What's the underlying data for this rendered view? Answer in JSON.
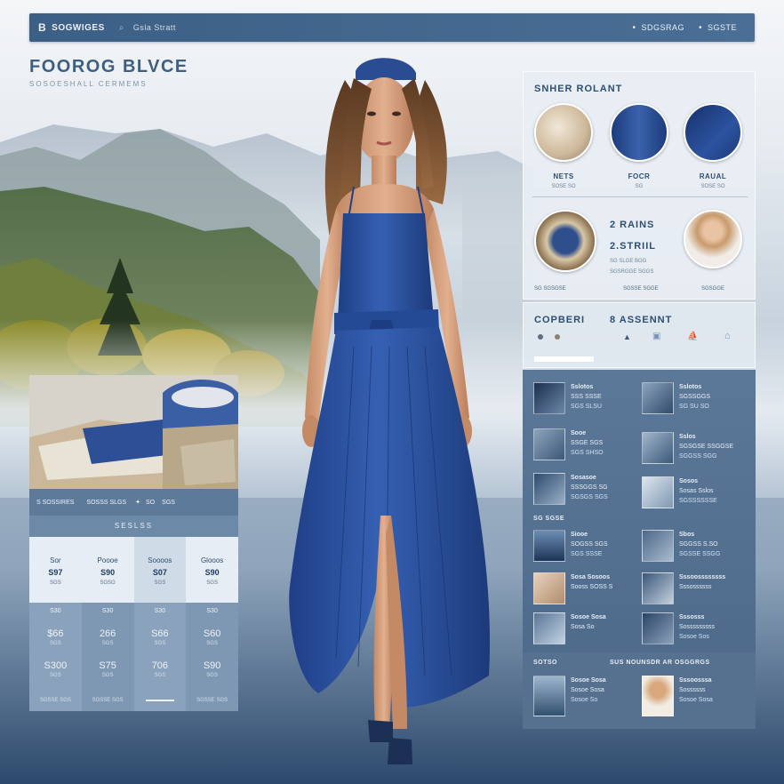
{
  "topbar": {
    "logo": "B",
    "brand": "SOGWIGES",
    "section": "Gsla Stratt",
    "nav": [
      "SDGSRAG",
      "SGSTE"
    ]
  },
  "hero": {
    "title": "FOOROG BLVCE",
    "subtitle": "SOSOESHALL CERMEMS"
  },
  "shop_panel": {
    "title": "SNHER ROLANT",
    "items": [
      {
        "label": "NETS",
        "sub": "SOSE SO"
      },
      {
        "label": "FOCR",
        "sub": "SG"
      },
      {
        "label": "RAUAL",
        "sub": "SOSE SO"
      }
    ],
    "feature": {
      "line1": "2 RAINS",
      "line2": "2.STRIIL",
      "desc1": "SG SLGE BGG",
      "desc2": "SGSRGGE SGGS",
      "foot": [
        "SG SGSGSE",
        "SGSSE SGGE",
        "SGSGGE"
      ]
    }
  },
  "assent_panel": {
    "left_title": "COPBERI",
    "right_title": "8 ASSENNT",
    "icons": [
      "dot-icon",
      "dot-icon",
      "drop-icon",
      "shirt-icon",
      "ship-icon",
      "house-icon"
    ]
  },
  "products": {
    "section_a": "SG SGSE",
    "section_b_left": "SOTSO",
    "section_b_right": "SUS NOUNSDR AR OSGGRGS",
    "left": [
      {
        "name": "Sslotos",
        "desc": "SSS SSSE",
        "price": "SGS SLSU"
      },
      {
        "name": "Sooe",
        "desc": "SSGE SGS",
        "price": "SGS SHSO"
      },
      {
        "name": "Sosasoe",
        "desc": "SSSGGS SG",
        "price": "SGSGS SGS"
      },
      {
        "name": "Siooe",
        "desc": "SOGSS SGS",
        "price": "SGS SSSE"
      },
      {
        "name": "Sosa Sosoos",
        "desc": "Sooss SOSS S",
        "price": ""
      },
      {
        "name": "Sosoe Sosa",
        "desc": "Sosa So",
        "price": ""
      },
      {
        "name": "Sosoe Sosa",
        "desc": "Sosoe Sosa",
        "price": "Sosoe So"
      }
    ],
    "right": [
      {
        "name": "Sslotos",
        "desc": "SGSSGGS",
        "price": "SG SU SO"
      },
      {
        "name": "Sslos",
        "desc": "SGSGSE SSGGSE",
        "price": "SGGSS SGG"
      },
      {
        "name": "Sosos",
        "desc": "Sosas Sslos",
        "price": "SGSSSSSSE"
      },
      {
        "name": "Sbos",
        "desc": "SGGSS S.SO",
        "price": "SGSSE SSGG"
      },
      {
        "name": "Sssoossssssss",
        "desc": "Sssossssss",
        "price": ""
      },
      {
        "name": "Sssosss",
        "desc": "Sosssssssss",
        "price": "Sosoe Sos"
      },
      {
        "name": "Sssoosssa",
        "desc": "Sossssss",
        "price": "Sosoe Sosa"
      }
    ]
  },
  "left_card": {
    "toolbar": [
      "S SOSSIRES",
      "SOSSS SLGS",
      "SO",
      "SGS"
    ],
    "pricing_title": "SESLSS",
    "columns": [
      {
        "name": "Sor",
        "price": "S97",
        "note": "SGS",
        "r1": "S30",
        "r2": "$66",
        "r2s": "SGS",
        "r3": "S300",
        "r3s": "SGS"
      },
      {
        "name": "Poooe",
        "price": "S90",
        "note": "SGSG",
        "r1": "S30",
        "r2": "266",
        "r2s": "SGS",
        "r3": "S75",
        "r3s": "SGS"
      },
      {
        "name": "Soooos",
        "price": "S07",
        "note": "SGS",
        "r1": "S30",
        "r2": "S66",
        "r2s": "SGS",
        "r3": "706",
        "r3s": "SGS"
      },
      {
        "name": "Glooos",
        "price": "S90",
        "note": "SGS",
        "r1": "S30",
        "r2": "S60",
        "r2s": "SGS",
        "r3": "S90",
        "r3s": "SGS"
      }
    ],
    "footer": [
      "SGSSE SGS",
      "SGSSE SGS",
      "SGSSE SGS"
    ]
  },
  "colors": {
    "accent": "#2f55a0",
    "panel": "#e8eef4",
    "panel_dark": "#4b6889",
    "topbar": "#3c5f86"
  }
}
